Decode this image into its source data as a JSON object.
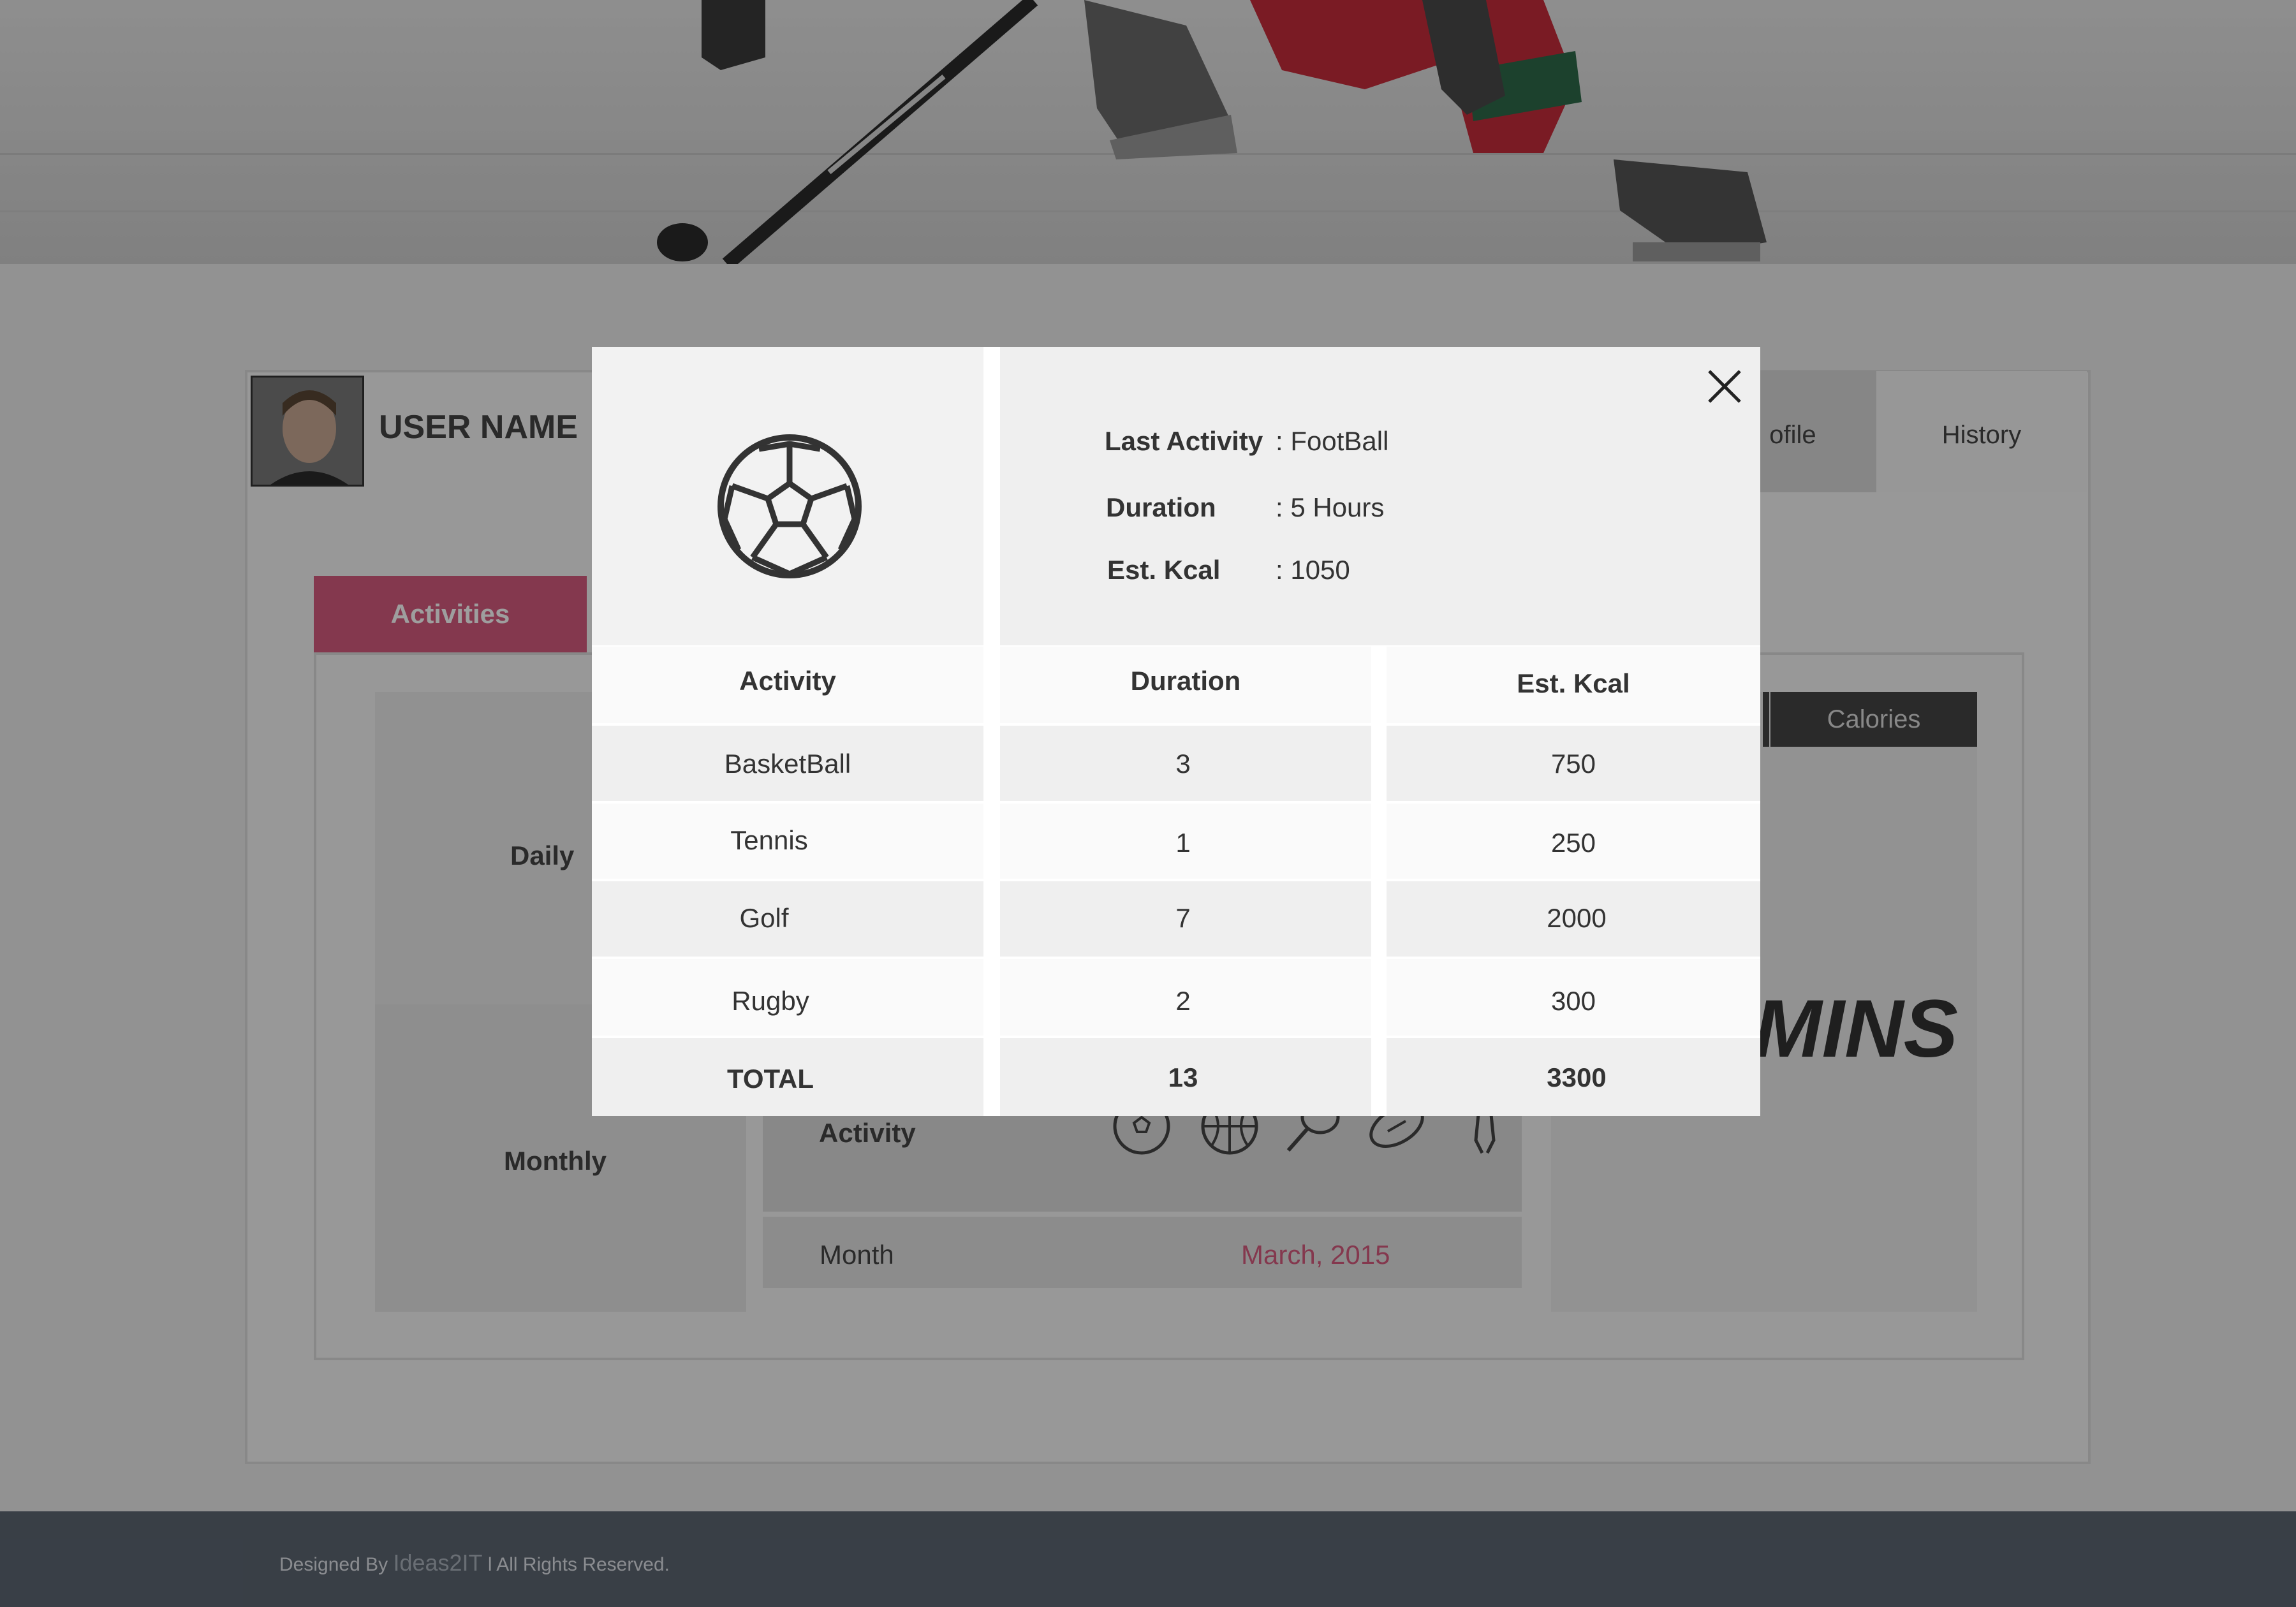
{
  "header": {
    "username": "USER NAME",
    "tabs": [
      {
        "label": "ofile"
      },
      {
        "label": "History"
      }
    ]
  },
  "activities": {
    "tab_label": "Activities",
    "daily_label": "Daily",
    "monthly_label": "Monthly",
    "activity_row_label": "Activity",
    "month_row_label": "Month",
    "month_value": "March, 2015",
    "calories_button": "Calories",
    "big_value_text": "MINS"
  },
  "modal": {
    "summary": {
      "last_activity_label": "Last Activity",
      "last_activity_value": ": FootBall",
      "duration_label": "Duration",
      "duration_value": ": 5 Hours",
      "kcal_label": "Est. Kcal",
      "kcal_value": ": 1050"
    },
    "table": {
      "headers": [
        "Activity",
        "Duration",
        "Est. Kcal"
      ],
      "rows": [
        [
          "BasketBall",
          "3",
          "750"
        ],
        [
          "Tennis",
          "1",
          "250"
        ],
        [
          "Golf",
          "7",
          "2000"
        ],
        [
          "Rugby",
          "2",
          "300"
        ]
      ],
      "total": [
        "TOTAL",
        "13",
        "3300"
      ]
    }
  },
  "footer": {
    "prefix": "Designed By",
    "brand": "Ideas2IT",
    "suffix": "l All Rights Reserved."
  },
  "colors": {
    "accent": "#d65b7e",
    "footer_bg": "#5c6672",
    "dark_button": "#454545"
  },
  "icons": [
    "soccer-ball-icon",
    "close-icon",
    "basketball-icon",
    "tennis-racket-icon",
    "rugby-ball-icon",
    "volleyball-icon",
    "skating-icon"
  ]
}
